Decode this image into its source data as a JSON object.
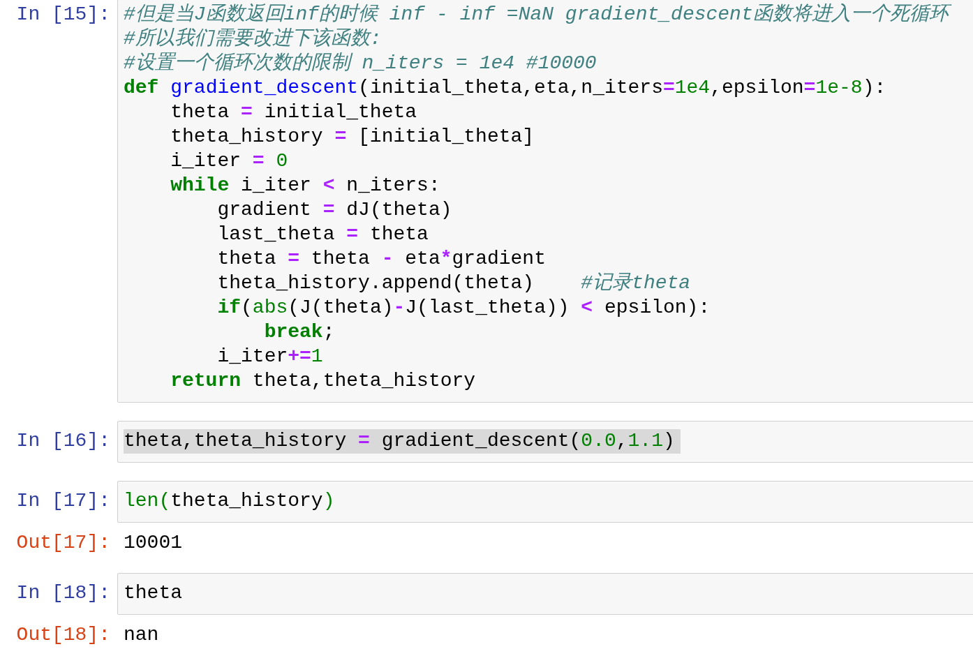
{
  "cells": [
    {
      "prompt": "In [15]:",
      "highlighted": false,
      "lines": [
        [
          {
            "kind": "comment",
            "text": "#但是当J函数返回inf的时候 inf - inf =NaN gradient_descent函数将进入一个死循环"
          }
        ],
        [
          {
            "kind": "comment",
            "text": "#所以我们需要改进下该函数:"
          }
        ],
        [
          {
            "kind": "comment",
            "text": "#设置一个循环次数的限制 n_iters = 1e4 #10000"
          }
        ],
        [
          {
            "kind": "keyword",
            "text": "def"
          },
          {
            "kind": "defname",
            "text": " gradient_descent"
          },
          {
            "kind": "text",
            "text": "(initial_theta,eta,n_iters"
          },
          {
            "kind": "op",
            "text": "="
          },
          {
            "kind": "number",
            "text": "1e4"
          },
          {
            "kind": "text",
            "text": ",epsilon"
          },
          {
            "kind": "op",
            "text": "="
          },
          {
            "kind": "number",
            "text": "1e-8"
          },
          {
            "kind": "text",
            "text": "):"
          }
        ],
        [
          {
            "kind": "text",
            "text": "    theta "
          },
          {
            "kind": "op",
            "text": "="
          },
          {
            "kind": "text",
            "text": " initial_theta"
          }
        ],
        [
          {
            "kind": "text",
            "text": "    theta_history "
          },
          {
            "kind": "op",
            "text": "="
          },
          {
            "kind": "text",
            "text": " [initial_theta]"
          }
        ],
        [
          {
            "kind": "text",
            "text": "    i_iter "
          },
          {
            "kind": "op",
            "text": "="
          },
          {
            "kind": "number",
            "text": " 0"
          }
        ],
        [
          {
            "kind": "keyword",
            "text": "    while"
          },
          {
            "kind": "text",
            "text": " i_iter "
          },
          {
            "kind": "op",
            "text": "<"
          },
          {
            "kind": "text",
            "text": " n_iters:"
          }
        ],
        [
          {
            "kind": "text",
            "text": "        gradient "
          },
          {
            "kind": "op",
            "text": "="
          },
          {
            "kind": "text",
            "text": " dJ(theta)"
          }
        ],
        [
          {
            "kind": "text",
            "text": "        last_theta "
          },
          {
            "kind": "op",
            "text": "="
          },
          {
            "kind": "text",
            "text": " theta"
          }
        ],
        [
          {
            "kind": "text",
            "text": "        theta "
          },
          {
            "kind": "op",
            "text": "="
          },
          {
            "kind": "text",
            "text": " theta "
          },
          {
            "kind": "op",
            "text": "-"
          },
          {
            "kind": "text",
            "text": " eta"
          },
          {
            "kind": "op",
            "text": "*"
          },
          {
            "kind": "text",
            "text": "gradient"
          }
        ],
        [
          {
            "kind": "text",
            "text": "        theta_history.append(theta)    "
          },
          {
            "kind": "comment",
            "text": "#记录theta"
          }
        ],
        [
          {
            "kind": "keyword",
            "text": "        if"
          },
          {
            "kind": "text",
            "text": "("
          },
          {
            "kind": "builtin",
            "text": "abs"
          },
          {
            "kind": "text",
            "text": "(J(theta)"
          },
          {
            "kind": "op",
            "text": "-"
          },
          {
            "kind": "text",
            "text": "J(last_theta)) "
          },
          {
            "kind": "op",
            "text": "<"
          },
          {
            "kind": "text",
            "text": " epsilon):"
          }
        ],
        [
          {
            "kind": "keyword",
            "text": "            break"
          },
          {
            "kind": "text",
            "text": ";"
          }
        ],
        [
          {
            "kind": "text",
            "text": "        i_iter"
          },
          {
            "kind": "op",
            "text": "+="
          },
          {
            "kind": "number",
            "text": "1"
          }
        ],
        [
          {
            "kind": "keyword",
            "text": "    return"
          },
          {
            "kind": "text",
            "text": " theta,theta_history"
          }
        ]
      ]
    },
    {
      "prompt": "In [16]:",
      "highlighted": true,
      "lines": [
        [
          {
            "kind": "text",
            "text": "theta,theta_history "
          },
          {
            "kind": "op",
            "text": "="
          },
          {
            "kind": "text",
            "text": " gradient_descent("
          },
          {
            "kind": "number",
            "text": "0.0"
          },
          {
            "kind": "text",
            "text": ","
          },
          {
            "kind": "number",
            "text": "1.1"
          },
          {
            "kind": "text",
            "text": ")"
          }
        ]
      ]
    },
    {
      "prompt": "In [17]:",
      "highlighted": false,
      "lines": [
        [
          {
            "kind": "builtin",
            "text": "len("
          },
          {
            "kind": "text",
            "text": "theta_history"
          },
          {
            "kind": "builtin",
            "text": ")"
          }
        ]
      ],
      "output": {
        "prompt": "Out[17]:",
        "text": "10001"
      }
    },
    {
      "prompt": "In [18]:",
      "highlighted": false,
      "lines": [
        [
          {
            "kind": "text",
            "text": "theta"
          }
        ]
      ],
      "output": {
        "prompt": "Out[18]:",
        "text": "nan"
      }
    }
  ]
}
